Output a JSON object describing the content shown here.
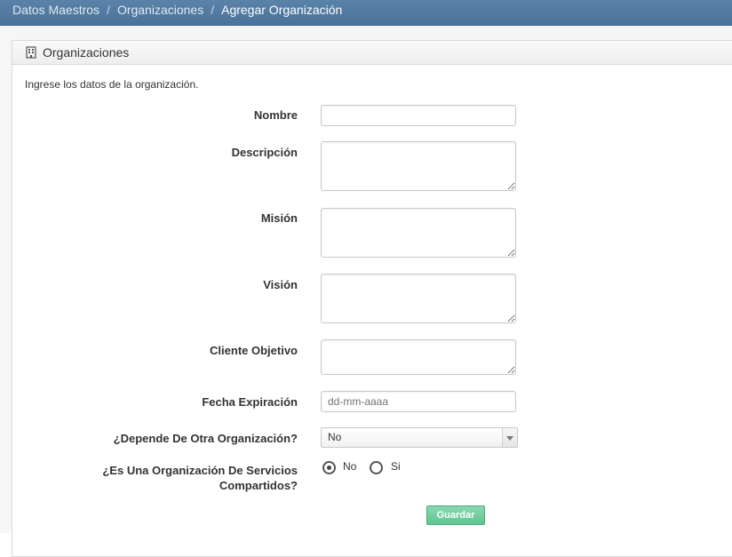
{
  "breadcrumb": {
    "items": [
      "Datos Maestros",
      "Organizaciones"
    ],
    "current": "Agregar Organización",
    "separator": "/"
  },
  "panel": {
    "icon": "building-icon",
    "title": "Organizaciones",
    "intro": "Ingrese los datos de la organización."
  },
  "form": {
    "nombre": {
      "label": "Nombre",
      "value": ""
    },
    "descripcion": {
      "label": "Descripción",
      "value": ""
    },
    "mision": {
      "label": "Misión",
      "value": ""
    },
    "vision": {
      "label": "Visión",
      "value": ""
    },
    "cliente_objetivo": {
      "label": "Cliente Objetivo",
      "value": ""
    },
    "fecha_expiracion": {
      "label": "Fecha Expiración",
      "placeholder": "dd-mm-aaaa"
    },
    "depende": {
      "label": "¿Depende De Otra Organización?",
      "selected": "No"
    },
    "servicios_compartidos": {
      "label": "¿Es Una Organización De Servicios Compartidos?",
      "options": [
        {
          "label": "No",
          "checked": true
        },
        {
          "label": "Si",
          "checked": false
        }
      ]
    },
    "submit_label": "Guardar"
  },
  "colors": {
    "topbar": "#4b729a",
    "button": "#5fc591"
  }
}
